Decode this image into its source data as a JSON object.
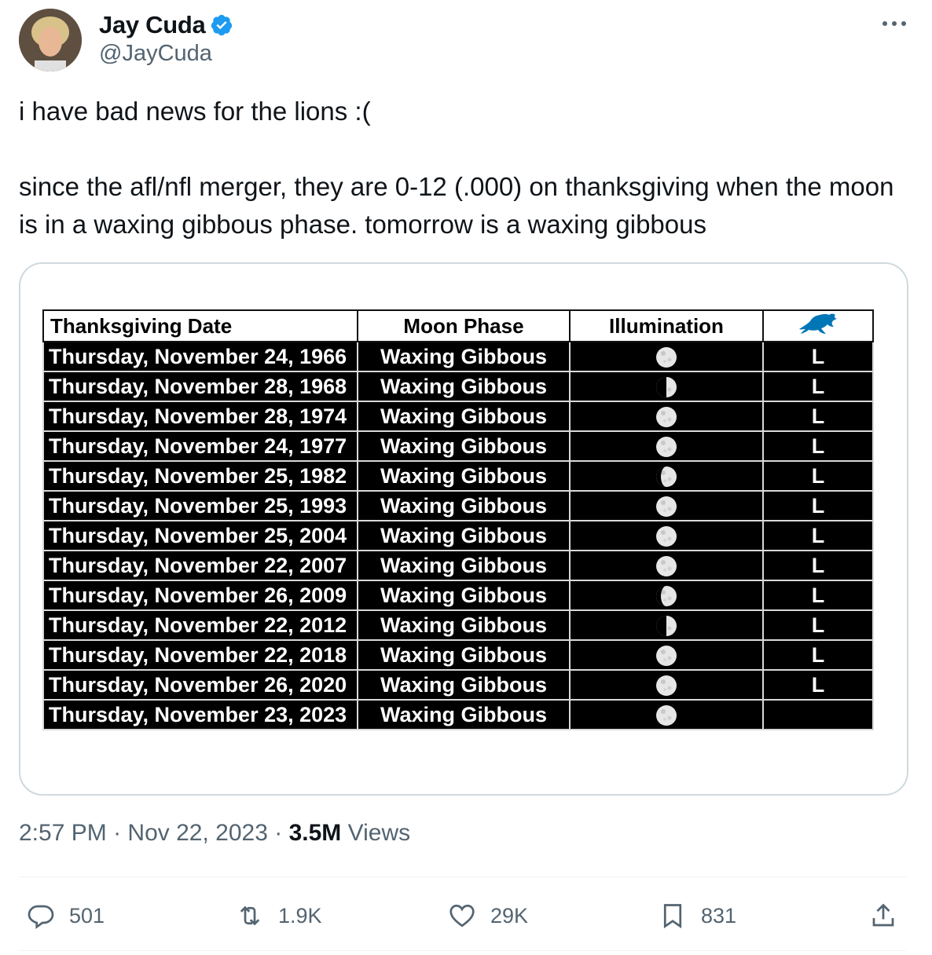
{
  "author": {
    "display_name": "Jay Cuda",
    "handle": "@JayCuda",
    "verified_icon": "verified-badge-icon"
  },
  "tweet": {
    "text": "i have bad news for the lions :(\n\nsince the afl/nfl merger, they are 0-12 (.000) on thanksgiving when the moon is in a waxing gibbous phase. tomorrow is a waxing gibbous"
  },
  "table": {
    "headers": [
      "Thanksgiving Date",
      "Moon Phase",
      "Illumination"
    ],
    "result_header_icon": "detroit-lions-logo-icon",
    "rows": [
      {
        "date": "Thursday, November 24, 1966",
        "phase": "Waxing Gibbous",
        "moon": "full",
        "result": "L"
      },
      {
        "date": "Thursday, November 28, 1968",
        "phase": "Waxing Gibbous",
        "moon": "half",
        "result": "L"
      },
      {
        "date": "Thursday, November 28, 1974",
        "phase": "Waxing Gibbous",
        "moon": "full",
        "result": "L"
      },
      {
        "date": "Thursday, November 24, 1977",
        "phase": "Waxing Gibbous",
        "moon": "full",
        "result": "L"
      },
      {
        "date": "Thursday, November 25, 1982",
        "phase": "Waxing Gibbous",
        "moon": "gibbous",
        "result": "L"
      },
      {
        "date": "Thursday, November 25, 1993",
        "phase": "Waxing Gibbous",
        "moon": "full",
        "result": "L"
      },
      {
        "date": "Thursday, November 25, 2004",
        "phase": "Waxing Gibbous",
        "moon": "full",
        "result": "L"
      },
      {
        "date": "Thursday, November 22, 2007",
        "phase": "Waxing Gibbous",
        "moon": "full",
        "result": "L"
      },
      {
        "date": "Thursday, November 26, 2009",
        "phase": "Waxing Gibbous",
        "moon": "gibbous",
        "result": "L"
      },
      {
        "date": "Thursday, November 22, 2012",
        "phase": "Waxing Gibbous",
        "moon": "half",
        "result": "L"
      },
      {
        "date": "Thursday, November 22, 2018",
        "phase": "Waxing Gibbous",
        "moon": "full",
        "result": "L"
      },
      {
        "date": "Thursday, November 26, 2020",
        "phase": "Waxing Gibbous",
        "moon": "full",
        "result": "L"
      },
      {
        "date": "Thursday, November 23, 2023",
        "phase": "Waxing Gibbous",
        "moon": "full",
        "result": ""
      }
    ]
  },
  "meta": {
    "time": "2:57 PM",
    "sep": "·",
    "date": "Nov 22, 2023",
    "views_count": "3.5M",
    "views_label": "Views"
  },
  "actions": {
    "replies": "501",
    "reposts": "1.9K",
    "likes": "29K",
    "bookmarks": "831"
  },
  "colors": {
    "text": "#0f1419",
    "secondary": "#536471",
    "verified": "#1d9bf0",
    "lions_blue": "#0076b6",
    "border": "#cfd9de"
  }
}
